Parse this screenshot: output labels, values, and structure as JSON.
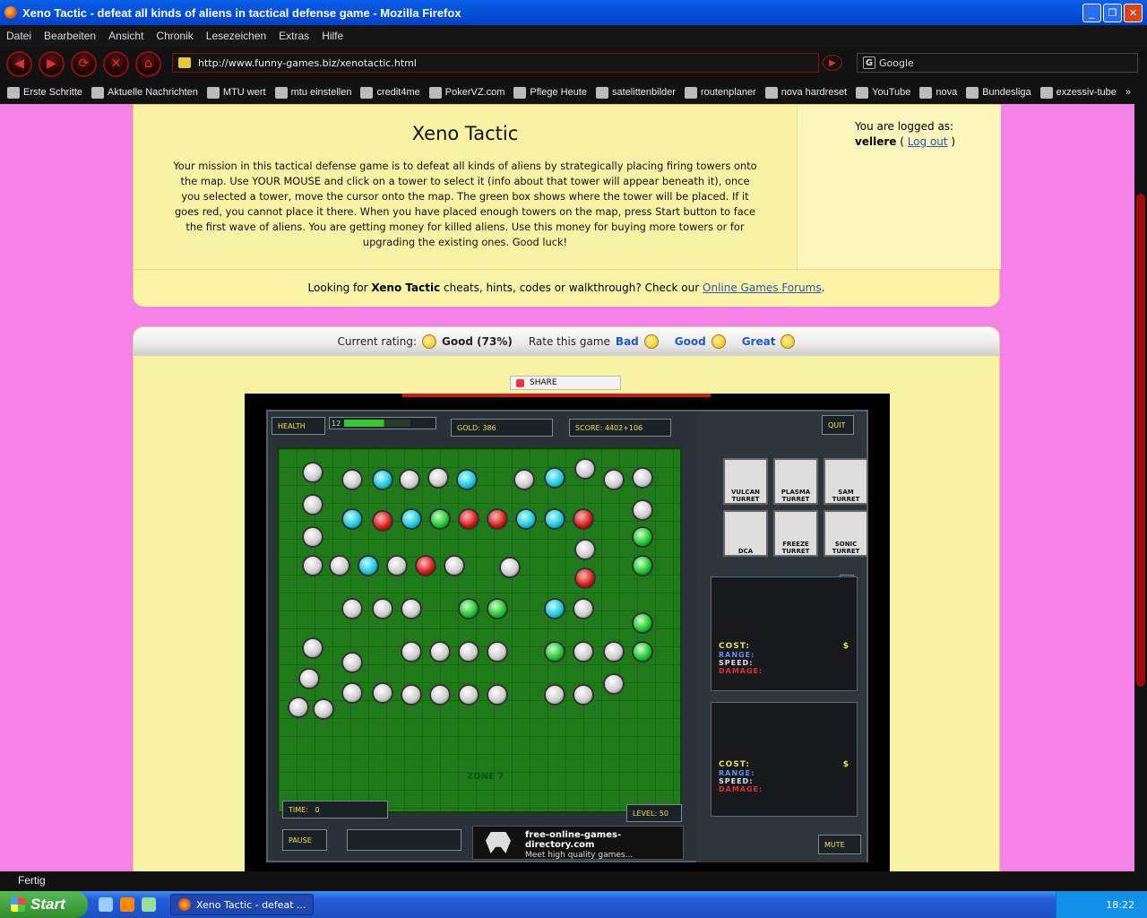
{
  "window": {
    "title": "Xeno Tactic - defeat all kinds of aliens in tactical defense game - Mozilla Firefox"
  },
  "menu": [
    "Datei",
    "Bearbeiten",
    "Ansicht",
    "Chronik",
    "Lesezeichen",
    "Extras",
    "Hilfe"
  ],
  "nav": {
    "url": "http://www.funny-games.biz/xenotactic.html",
    "search_value": "Google"
  },
  "bookmarks": [
    "Erste Schritte",
    "Aktuelle Nachrichten",
    "MTU wert",
    "mtu einstellen",
    "credit4me",
    "PokerVZ.com",
    "Pflege Heute",
    "satelittenbilder",
    "routenplaner",
    "nova hardreset",
    "YouTube",
    "nova",
    "Bundesliga",
    "exzessiv-tube"
  ],
  "game_page": {
    "title": "Xeno Tactic",
    "description": "Your mission in this tactical defense game is to defeat all kinds of aliens by strategically placing firing towers onto the map. Use YOUR MOUSE and click on a tower to select it (info about that tower will appear beneath it), once you selected a tower, move the cursor onto the map. The green box shows where the tower will be placed. If it goes red, you cannot place it there. When you have placed enough towers on the map, press Start button to face the first wave of aliens. You are getting money for killed aliens. Use this money for buying more towers or for upgrading the existing ones. Good luck!",
    "login_label": "You are logged as:",
    "username": "vellere",
    "logout": "Log out",
    "cheats_prefix": "Looking for",
    "cheats_game": "Xeno Tactic",
    "cheats_suffix": "cheats, hints, codes or walkthrough? Check our",
    "forum_link": "Online Games Forums"
  },
  "rating": {
    "current_label": "Current rating:",
    "current_value": "Good (73%)",
    "rate_label": "Rate this game",
    "bad": "Bad",
    "good": "Good",
    "great": "Great"
  },
  "share": "SHARE",
  "game": {
    "health_label": "HEALTH",
    "health_value": "12",
    "gold": "GOLD: 386",
    "score": "SCORE: 4402+106",
    "quit": "QUIT",
    "zone": "ZONE 7",
    "time_label": "TIME:",
    "time_value": "0",
    "level": "LEVEL: 50",
    "pause": "PAUSE",
    "mute": "MUTE",
    "towers": [
      "VULCAN TURRET",
      "PLASMA TURRET",
      "SAM TURRET",
      "DCA",
      "FREEZE TURRET",
      "SONIC TURRET"
    ],
    "info_cost": "COST:",
    "info_currency": "$",
    "info_range": "RANGE:",
    "info_speed": "SPEED:",
    "info_damage": "DAMAGE:",
    "ad_site": "free-online-games-directory.com",
    "ad_tag": "Meet high quality games..."
  },
  "status": "Fertig",
  "taskbar": {
    "start": "Start",
    "task": "Xeno Tactic - defeat ...",
    "clock": "18:22"
  }
}
